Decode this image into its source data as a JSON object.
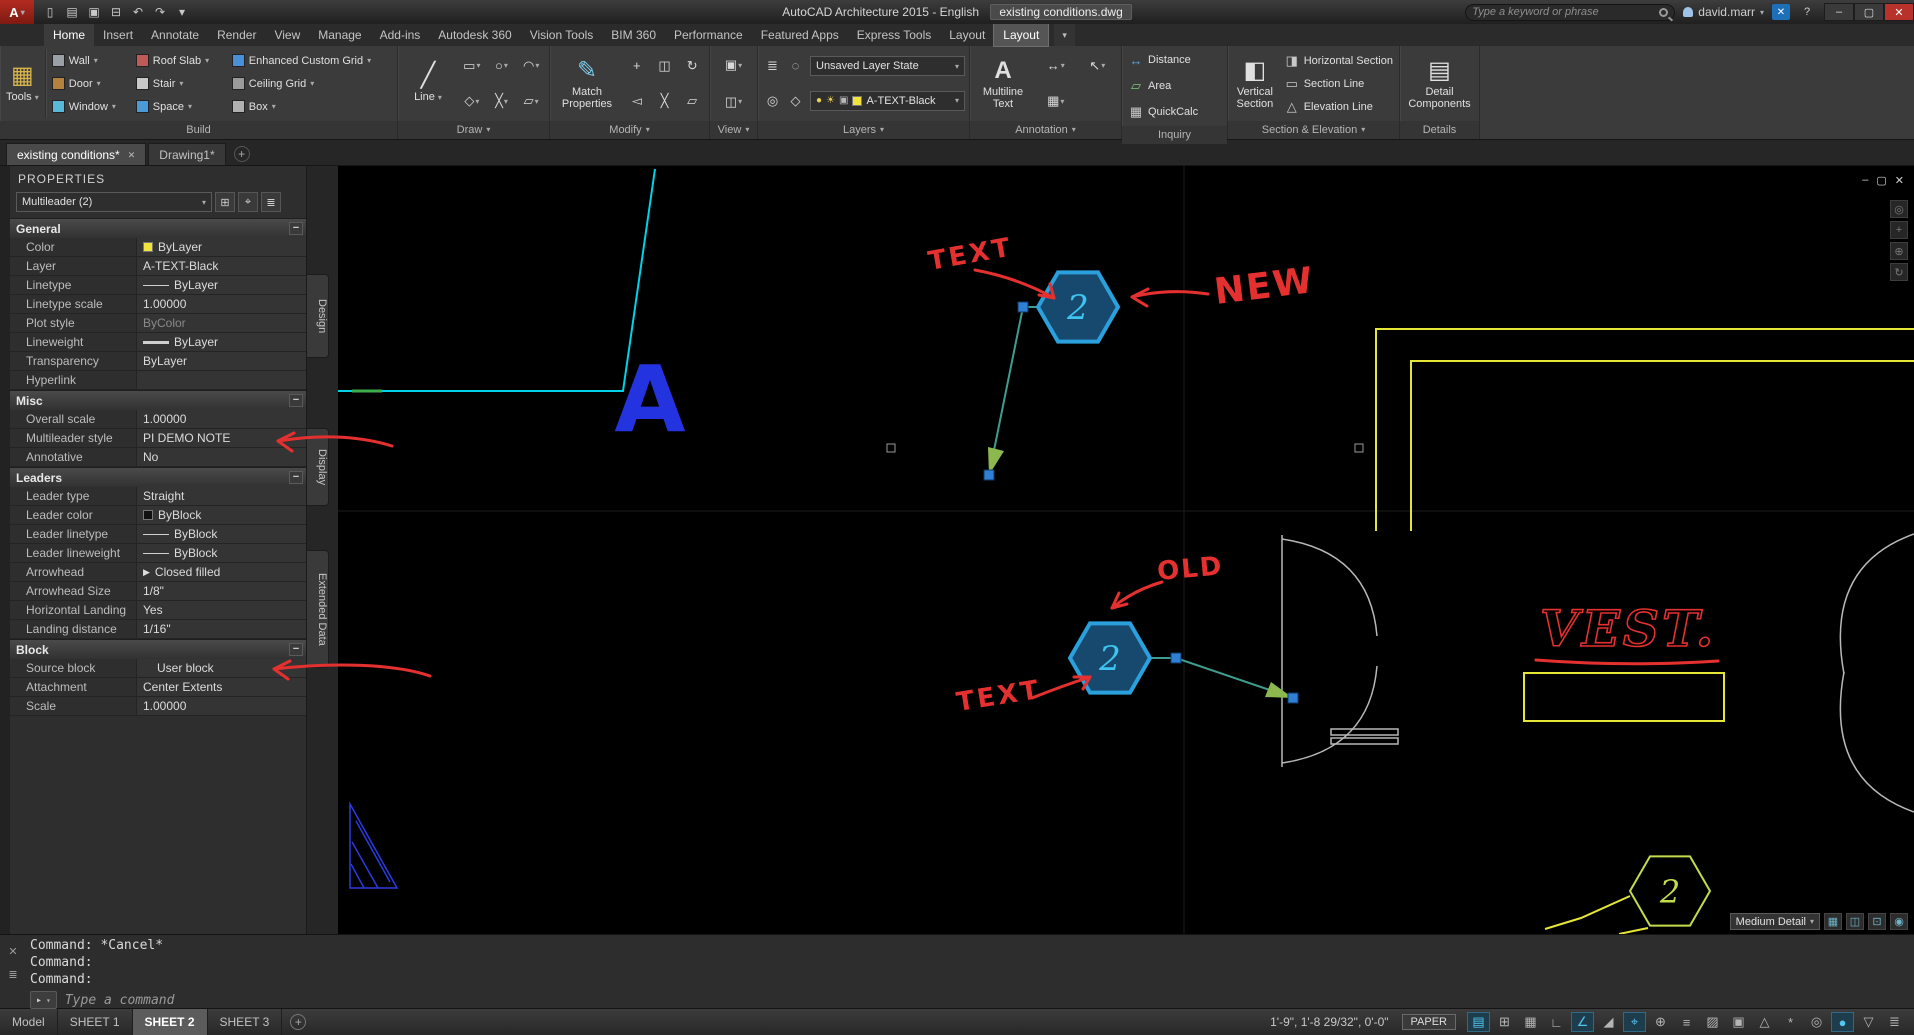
{
  "colors": {
    "annotation_red": "#e53030",
    "cyan_line": "#00d2e8",
    "wall_yellow": "#e6e636",
    "drawing_white": "#c0c0c0",
    "blue_letter": "#2433e0",
    "hex_fill": "#17496f",
    "hex_stroke": "#2aa0dd",
    "hex_text": "#3ec4ee",
    "hex3_green": "#c3dc4e",
    "leader_teal": "#3f9d8f",
    "arrow_green": "#8cb84f",
    "grip_blue": "#2f80d5",
    "layer_yellow": "#f0e43c"
  },
  "titlebar": {
    "app_title": "AutoCAD Architecture 2015 - English",
    "doc_name": "existing conditions.dwg",
    "search_placeholder": "Type a keyword or phrase",
    "user_name": "david.marr",
    "quick_access_icons": [
      {
        "name": "new-file-icon",
        "glyph": "▯"
      },
      {
        "name": "open-file-icon",
        "glyph": "▤"
      },
      {
        "name": "save-icon",
        "glyph": "▣"
      },
      {
        "name": "plot-icon",
        "glyph": "⊟"
      },
      {
        "name": "undo-icon",
        "glyph": "↶"
      },
      {
        "name": "redo-icon",
        "glyph": "↷"
      },
      {
        "name": "qat-menu-icon",
        "glyph": "▾"
      }
    ]
  },
  "ribbon": {
    "display_toggle_icon": "▾",
    "tabs": [
      {
        "label": "Home",
        "active": true
      },
      {
        "label": "Insert"
      },
      {
        "label": "Annotate"
      },
      {
        "label": "Render"
      },
      {
        "label": "View"
      },
      {
        "label": "Manage"
      },
      {
        "label": "Add-ins"
      },
      {
        "label": "Autodesk 360"
      },
      {
        "label": "Vision Tools"
      },
      {
        "label": "BIM 360"
      },
      {
        "label": "Performance"
      },
      {
        "label": "Featured Apps"
      },
      {
        "label": "Express Tools"
      },
      {
        "label": "Layout"
      },
      {
        "label": "Layout",
        "highlight": true
      }
    ],
    "panels": {
      "build": {
        "label": "Build",
        "tools_label": "Tools",
        "col1": [
          {
            "label": "Wall",
            "icon": "#9aa0a6"
          },
          {
            "label": "Door",
            "icon": "#b5813f"
          },
          {
            "label": "Window",
            "icon": "#59b7d8"
          }
        ],
        "col2": [
          {
            "label": "Roof Slab",
            "icon": "#c05a5a"
          },
          {
            "label": "Stair",
            "icon": "#c9c9c9"
          },
          {
            "label": "Space",
            "icon": "#4a9ad8"
          }
        ],
        "col3": [
          {
            "label": "Enhanced Custom Grid",
            "icon": "#4a90d8"
          },
          {
            "label": "Ceiling Grid",
            "icon": "#9a9a9a"
          },
          {
            "label": "Box",
            "icon": "#b0b0b0"
          }
        ]
      },
      "draw": {
        "label": "Draw",
        "line_label": "Line",
        "tool_icons": [
          {
            "name": "polyline-icon",
            "glyph": "▭"
          },
          {
            "name": "circle-icon",
            "glyph": "○"
          },
          {
            "name": "arc-icon",
            "glyph": "◠"
          },
          {
            "name": "rectangle-icon",
            "glyph": "◇"
          },
          {
            "name": "hatch-icon",
            "glyph": "╳"
          },
          {
            "name": "region-icon",
            "glyph": "▱"
          }
        ]
      },
      "modify": {
        "label": "Modify",
        "match_label": "Match Properties",
        "tool_icons": [
          {
            "name": "move-icon",
            "glyph": "+"
          },
          {
            "name": "copy-icon",
            "glyph": "◫"
          },
          {
            "name": "rotate-icon",
            "glyph": "↻"
          },
          {
            "name": "mirror-icon",
            "glyph": "◅"
          },
          {
            "name": "trim-icon",
            "glyph": "╳"
          },
          {
            "name": "erase-icon",
            "glyph": "▱"
          }
        ]
      },
      "view": {
        "label": "View",
        "tool_icons": [
          {
            "name": "named-views-icon",
            "glyph": "▣"
          },
          {
            "name": "viewport-config-icon",
            "glyph": "◫"
          }
        ]
      },
      "layers": {
        "label": "Layers",
        "state_value": "Unsaved Layer State",
        "layer_value": "A-TEXT-Black",
        "tool_icons": [
          {
            "name": "layer-properties-icon",
            "glyph": "≣"
          },
          {
            "name": "layer-off-icon",
            "glyph": "◌"
          },
          {
            "name": "layer-isolate-icon",
            "glyph": "◎"
          },
          {
            "name": "layer-freeze-icon",
            "glyph": "◇"
          }
        ],
        "layer_state_icons": [
          {
            "name": "layer-on-icon",
            "glyph": "●",
            "color": "#e8d44a"
          },
          {
            "name": "layer-thaw-icon",
            "glyph": "☀",
            "color": "#e8d44a"
          },
          {
            "name": "layer-lock-icon",
            "glyph": "▣",
            "color": "#b8b8b8"
          }
        ]
      },
      "annotation": {
        "label": "Annotation",
        "mtext_label": "Multiline Text",
        "tool_icons": [
          {
            "name": "dimension-icon",
            "glyph": "↔"
          },
          {
            "name": "leader-icon",
            "glyph": "↖"
          },
          {
            "name": "table-icon",
            "glyph": "▦"
          }
        ]
      },
      "inquiry": {
        "label": "Inquiry",
        "items": [
          {
            "label": "Distance",
            "glyph": "↔",
            "name": "distance-icon",
            "color": "#5aa8e8"
          },
          {
            "label": "Area",
            "glyph": "▱",
            "name": "area-icon",
            "color": "#7ac87a"
          },
          {
            "label": "QuickCalc",
            "glyph": "▦",
            "name": "quickcalc-icon",
            "color": "#c8c8c8"
          }
        ]
      },
      "section": {
        "label": "Section & Elevation",
        "vertical_label": "Vertical Section",
        "items": [
          {
            "label": "Horizontal Section",
            "glyph": "◨",
            "name": "horizontal-section-icon",
            "color": "#c8c8c8"
          },
          {
            "label": "Section Line",
            "glyph": "▭",
            "name": "section-line-icon",
            "color": "#c8c8c8"
          },
          {
            "label": "Elevation Line",
            "glyph": "△",
            "name": "elevation-line-icon",
            "color": "#c8c8c8"
          }
        ]
      },
      "details": {
        "label": "Details",
        "button_label": "Detail Components"
      }
    }
  },
  "file_tabs": [
    {
      "label": "existing conditions*",
      "active": true
    },
    {
      "label": "Drawing1*"
    }
  ],
  "properties": {
    "title": "PROPERTIES",
    "selector_value": "Multileader (2)",
    "header_icons": [
      {
        "name": "toggle-pickadd-icon",
        "glyph": "⊞"
      },
      {
        "name": "select-objects-icon",
        "glyph": "⌖"
      },
      {
        "name": "quick-select-icon",
        "glyph": "≣"
      }
    ],
    "groups": [
      {
        "name": "General",
        "rows": [
          {
            "label": "Color",
            "value": "ByLayer",
            "swatch": "#f0e43c"
          },
          {
            "label": "Layer",
            "value": "A-TEXT-Black"
          },
          {
            "label": "Linetype",
            "value": "ByLayer",
            "line": true
          },
          {
            "label": "Linetype scale",
            "value": "1.00000"
          },
          {
            "label": "Plot style",
            "value": "ByColor",
            "dim": true
          },
          {
            "label": "Lineweight",
            "value": "ByLayer",
            "thick": true
          },
          {
            "label": "Transparency",
            "value": "ByLayer"
          },
          {
            "label": "Hyperlink",
            "value": ""
          }
        ]
      },
      {
        "name": "Misc",
        "rows": [
          {
            "label": "Overall scale",
            "value": "1.00000"
          },
          {
            "label": "Multileader style",
            "value": "PI DEMO NOTE"
          },
          {
            "label": "Annotative",
            "value": "No"
          }
        ]
      },
      {
        "name": "Leaders",
        "rows": [
          {
            "label": "Leader type",
            "value": "Straight"
          },
          {
            "label": "Leader color",
            "value": "ByBlock",
            "swatch": "#111111"
          },
          {
            "label": "Leader linetype",
            "value": "ByBlock",
            "line": true
          },
          {
            "label": "Leader lineweight",
            "value": "ByBlock",
            "line": true
          },
          {
            "label": "Arrowhead",
            "value": "Closed filled",
            "arrow": true
          },
          {
            "label": "Arrowhead Size",
            "value": "1/8\""
          },
          {
            "label": "Horizontal Landing",
            "value": "Yes"
          },
          {
            "label": "Landing distance",
            "value": "1/16\""
          }
        ]
      },
      {
        "name": "Block",
        "rows": [
          {
            "label": "Source block",
            "value": "User block",
            "indent": true
          },
          {
            "label": "Attachment",
            "value": "Center Extents"
          },
          {
            "label": "Scale",
            "value": "1.00000"
          }
        ]
      }
    ]
  },
  "side_tabs": [
    {
      "label": "Design",
      "name": "palette-tab-design",
      "cls": "st1"
    },
    {
      "label": "Display",
      "name": "palette-tab-display",
      "cls": "st2"
    },
    {
      "label": "Extended Data",
      "name": "palette-tab-extended-data",
      "cls": "st3"
    }
  ],
  "canvas": {
    "big_letter": "A",
    "hex1_label": "2",
    "hex2_label": "2",
    "hex3_label": "2",
    "red_notes": {
      "text_top": "TEXT",
      "new_label": "NEW",
      "old_label": "OLD",
      "text_bottom": "TEXT",
      "vest_label": "VEST."
    },
    "display_config_label": "Medium Detail",
    "viewport_icons": [
      {
        "name": "viewport-scale-icon",
        "glyph": "▦"
      },
      {
        "name": "display-configuration-icon",
        "glyph": "◫"
      },
      {
        "name": "cut-plane-icon",
        "glyph": "⊡"
      },
      {
        "name": "render-mode-icon",
        "glyph": "◉"
      }
    ],
    "window_icons": [
      {
        "name": "viewport-minimize-icon",
        "glyph": "–"
      },
      {
        "name": "viewport-restore-icon",
        "glyph": "▢"
      },
      {
        "name": "viewport-close-icon",
        "glyph": "✕"
      }
    ],
    "navbar_icons": [
      {
        "name": "full-navigation-wheel-icon",
        "glyph": "◎"
      },
      {
        "name": "pan-icon",
        "glyph": "+"
      },
      {
        "name": "zoom-icon",
        "glyph": "⊕"
      },
      {
        "name": "orbit-icon",
        "glyph": "↻"
      }
    ]
  },
  "command": {
    "lines": [
      {
        "text": "Command: *Cancel*"
      },
      {
        "text": "Command:"
      },
      {
        "text": "Command:"
      }
    ],
    "prompt_placeholder": "Type a command",
    "prompt_icon": "▸",
    "recent_icon": "▾",
    "side_icons": [
      {
        "name": "commandline-close-icon",
        "glyph": "✕"
      },
      {
        "name": "commandline-customize-icon",
        "glyph": "≣"
      }
    ]
  },
  "statusbar": {
    "layout_tabs": [
      {
        "label": "Model"
      },
      {
        "label": "SHEET 1"
      },
      {
        "label": "SHEET 2",
        "active": true
      },
      {
        "label": "SHEET 3"
      }
    ],
    "new_layout_icon": "+",
    "coordinates": "1'-9\", 1'-8 29/32\", 0'-0\"",
    "paper_label": "PAPER",
    "icons": [
      {
        "name": "model-paper-toggle-icon",
        "glyph": "▤",
        "on": true
      },
      {
        "name": "grid-icon",
        "glyph": "⊞",
        "on": false
      },
      {
        "name": "snap-icon",
        "glyph": "▦",
        "on": false
      },
      {
        "name": "ortho-icon",
        "glyph": "∟",
        "on": false
      },
      {
        "name": "polar-tracking-icon",
        "glyph": "∠",
        "on": true
      },
      {
        "name": "isometric-drafting-icon",
        "glyph": "◢",
        "on": false
      },
      {
        "name": "object-snap-icon",
        "glyph": "⌖",
        "on": true
      },
      {
        "name": "object-snap-tracking-icon",
        "glyph": "⊕",
        "on": false
      },
      {
        "name": "lineweight-display-icon",
        "glyph": "≡",
        "on": false
      },
      {
        "name": "transparency-icon",
        "glyph": "▨",
        "on": false
      },
      {
        "name": "selection-cycling-icon",
        "glyph": "▣",
        "on": false
      },
      {
        "name": "annotation-scale-icon",
        "glyph": "△",
        "on": false
      },
      {
        "name": "workspace-icon",
        "glyph": "*",
        "on": false
      },
      {
        "name": "isolate-objects-icon",
        "glyph": "◎",
        "on": false
      },
      {
        "name": "graphics-performance-icon",
        "glyph": "●",
        "on": true
      },
      {
        "name": "filter-icon",
        "glyph": "▽",
        "on": false
      },
      {
        "name": "customization-icon",
        "glyph": "≣",
        "on": false
      }
    ]
  }
}
